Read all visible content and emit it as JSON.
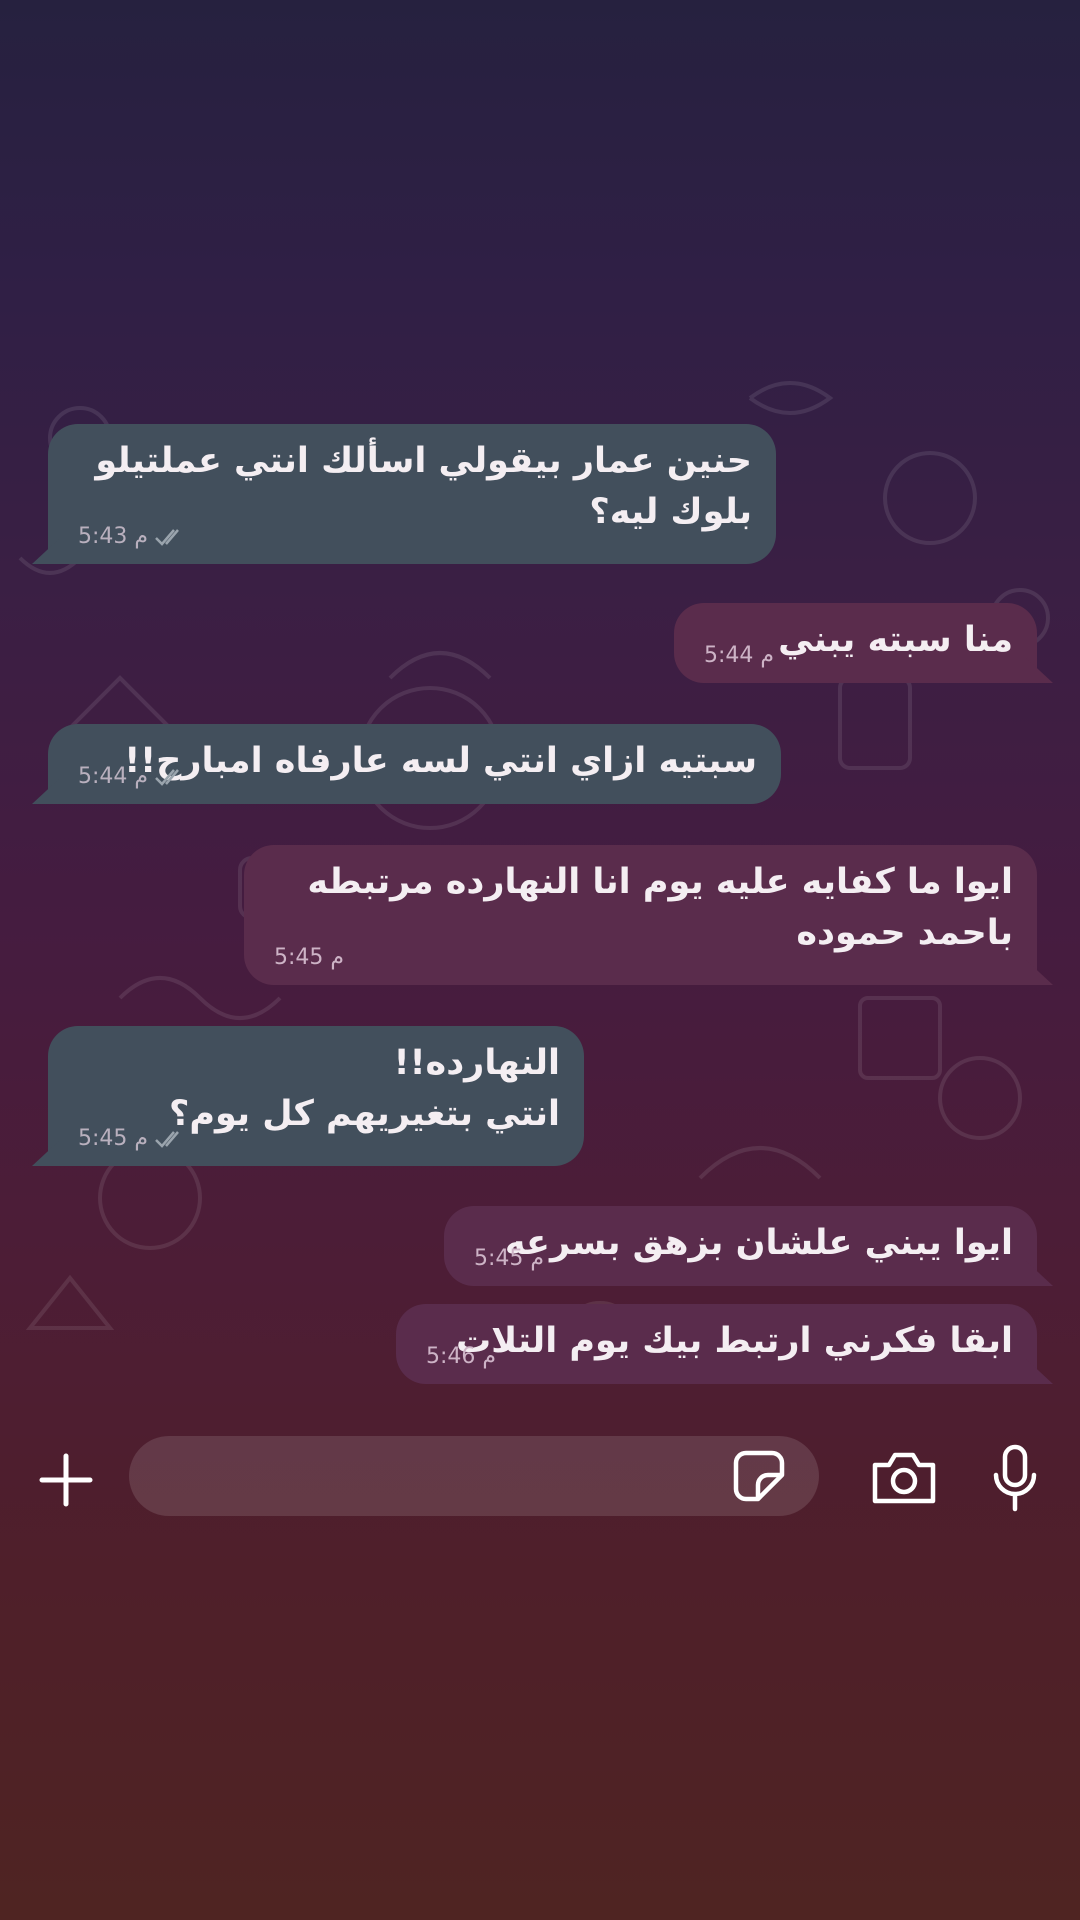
{
  "messages": [
    {
      "direction": "in",
      "text": "حنين عمار بيقولي اسألك انتي عملتيلو بلوك ليه؟",
      "time": "5:43 م",
      "status": "read"
    },
    {
      "direction": "out",
      "text": "منا سبته يبني",
      "time": "5:44 م"
    },
    {
      "direction": "in",
      "text": "سبتيه ازاي انتي لسه عارفاه امبارح!!",
      "time": "5:44 م",
      "status": "read"
    },
    {
      "direction": "out",
      "text": "ايوا ما كفايه عليه يوم انا النهارده مرتبطه باحمد حموده",
      "time": "5:45 م"
    },
    {
      "direction": "in",
      "text": "النهارده!!\nانتي بتغيريهم كل يوم؟",
      "time": "5:45 م",
      "status": "read"
    },
    {
      "direction": "out",
      "text": "ايوا يبني علشان بزهق بسرعه",
      "time": "5:45 م"
    },
    {
      "direction": "out",
      "text": "ابقا فكرني ارتبط بيك يوم التلات",
      "time": "5:46 م"
    }
  ],
  "composer": {
    "placeholder": "",
    "icons": {
      "attach": "plus-icon",
      "sticker": "sticker-icon",
      "camera": "camera-icon",
      "voice": "microphone-icon"
    }
  },
  "colors": {
    "incoming_bubble": "#424f5c",
    "outgoing_bubble": "#5a2c4c",
    "read_ticks": "#9aa4ad"
  }
}
